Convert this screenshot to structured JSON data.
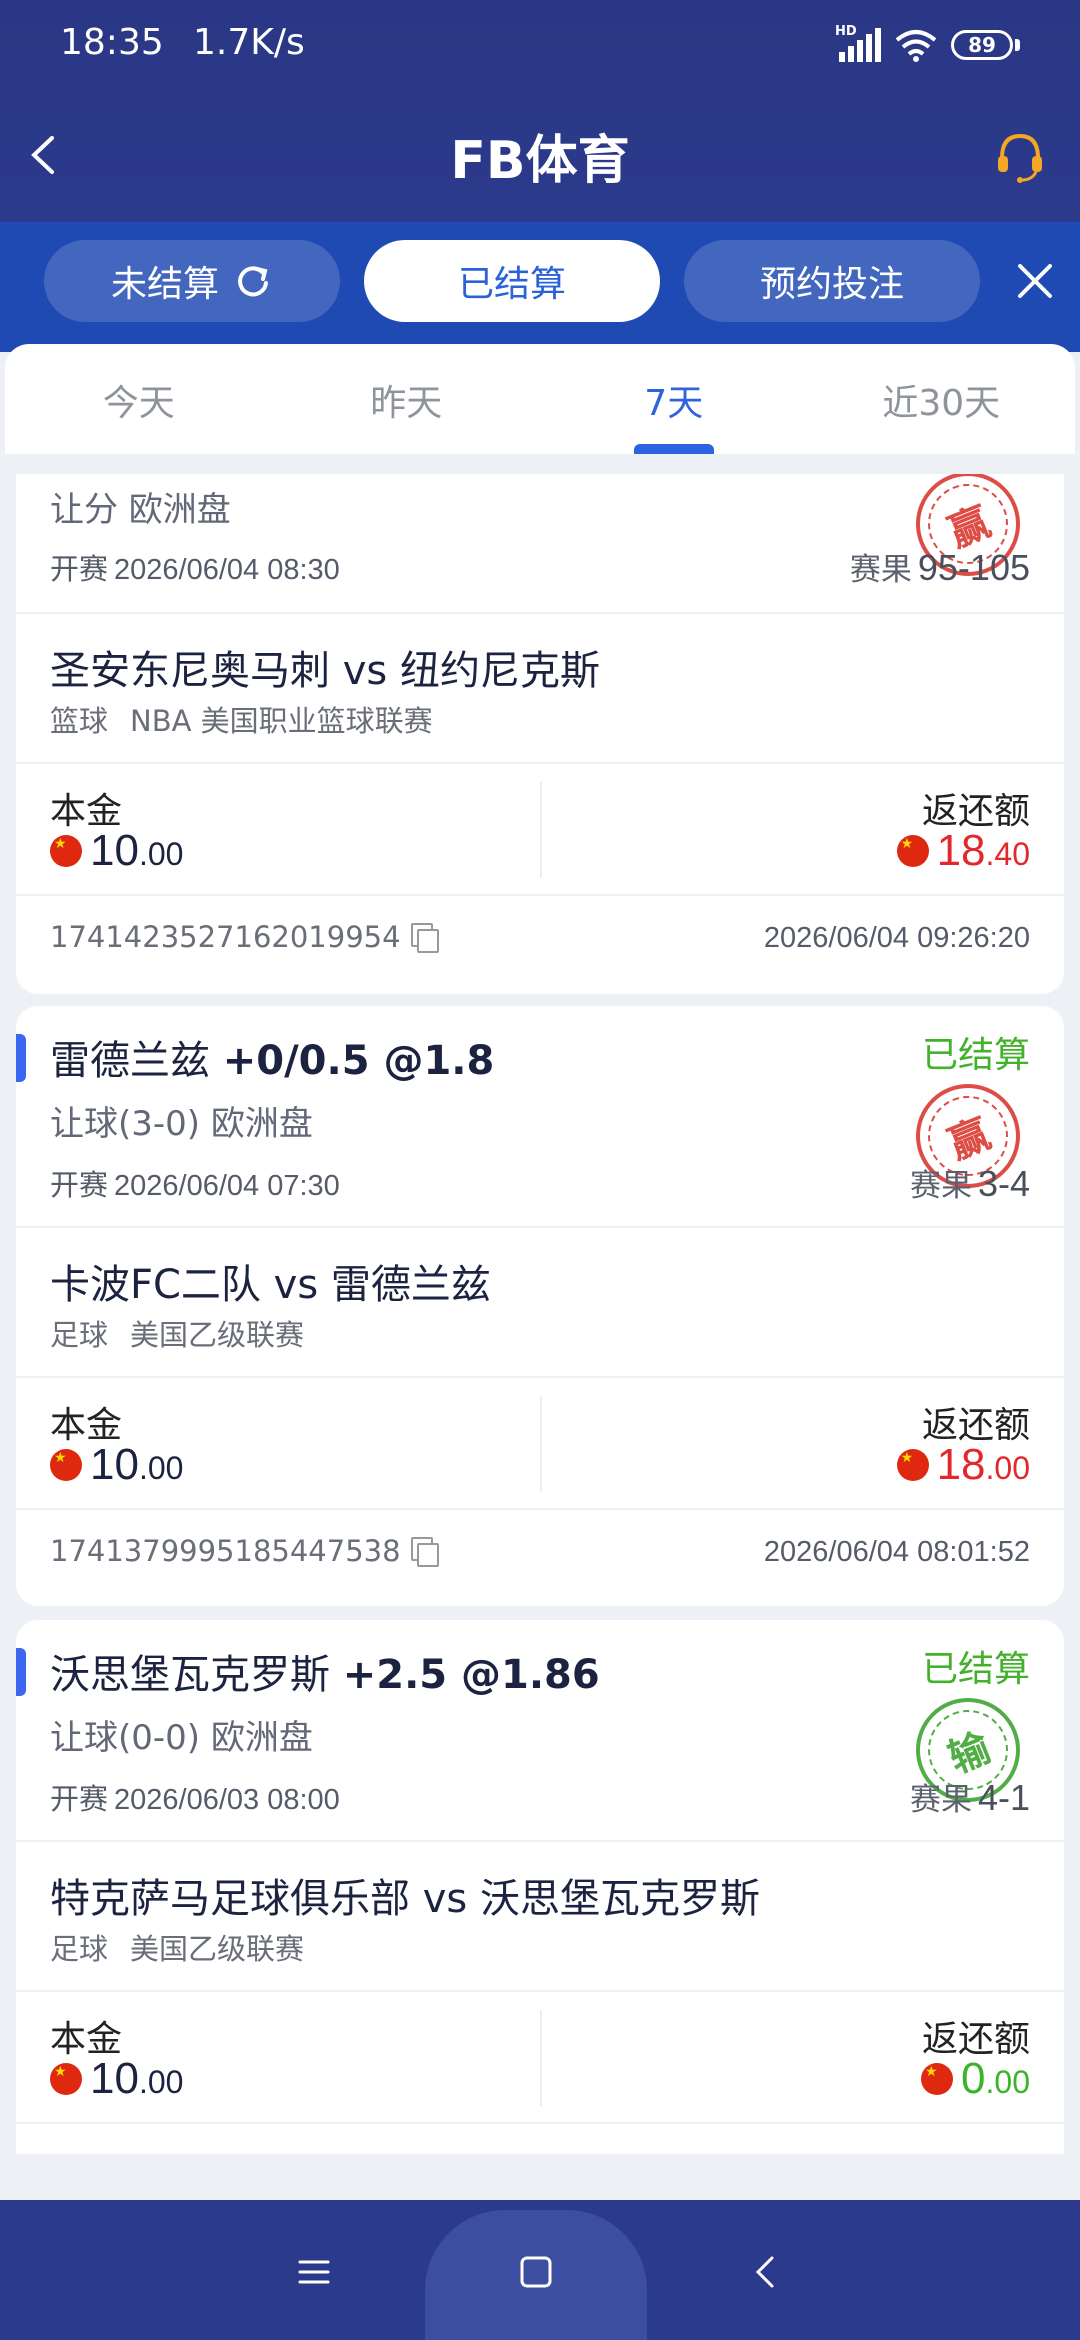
{
  "status_bar": {
    "time": "18:35",
    "speed": "1.7K/s",
    "network": "HD",
    "battery": "89"
  },
  "header": {
    "title": "FB体育"
  },
  "bet_tabs": [
    {
      "label": "未结算"
    },
    {
      "label": "已结算"
    },
    {
      "label": "预约投注"
    }
  ],
  "date_tabs": [
    {
      "label": "今天"
    },
    {
      "label": "昨天"
    },
    {
      "label": "7天"
    },
    {
      "label": "近30天"
    }
  ],
  "bets": [
    {
      "market": "让分 欧洲盘",
      "kickoff_label": "开赛",
      "kickoff": "2026/06/04 08:30",
      "result_label": "赛果",
      "result": "95-105",
      "stamp": "赢",
      "match": "圣安东尼奥马刺 vs 纽约尼克斯",
      "sport": "篮球",
      "league": "NBA 美国职业篮球联赛",
      "stake_label": "本金",
      "stake_int": "10",
      "stake_dec": ".00",
      "return_label": "返还额",
      "return_int": "18",
      "return_dec": ".40",
      "order_id": "1741423527162019954",
      "bet_time": "2026/06/04 09:26:20"
    },
    {
      "selection": "雷德兰兹",
      "line": "+0/0.5 @1.8",
      "status": "已结算",
      "market": "让球(3-0) 欧洲盘",
      "kickoff_label": "开赛",
      "kickoff": "2026/06/04 07:30",
      "result_label": "赛果",
      "result": "3-4",
      "stamp": "赢",
      "match": "卡波FC二队 vs 雷德兰兹",
      "sport": "足球",
      "league": "美国乙级联赛",
      "stake_label": "本金",
      "stake_int": "10",
      "stake_dec": ".00",
      "return_label": "返还额",
      "return_int": "18",
      "return_dec": ".00",
      "order_id": "1741379995185447538",
      "bet_time": "2026/06/04 08:01:52"
    },
    {
      "selection": "沃思堡瓦克罗斯",
      "line": "+2.5 @1.86",
      "status": "已结算",
      "market": "让球(0-0) 欧洲盘",
      "kickoff_label": "开赛",
      "kickoff": "2026/06/03 08:00",
      "result_label": "赛果",
      "result": "4-1",
      "stamp": "输",
      "match": "特克萨马足球俱乐部 vs 沃思堡瓦克罗斯",
      "sport": "足球",
      "league": "美国乙级联赛",
      "stake_label": "本金",
      "stake_int": "10",
      "stake_dec": ".00",
      "return_label": "返还额",
      "return_int": "0",
      "return_dec": ".00"
    }
  ],
  "colors": {
    "header": "#2a3785",
    "accent": "#2d62e0",
    "win": "#d9342c",
    "lose": "#3aa22c"
  }
}
